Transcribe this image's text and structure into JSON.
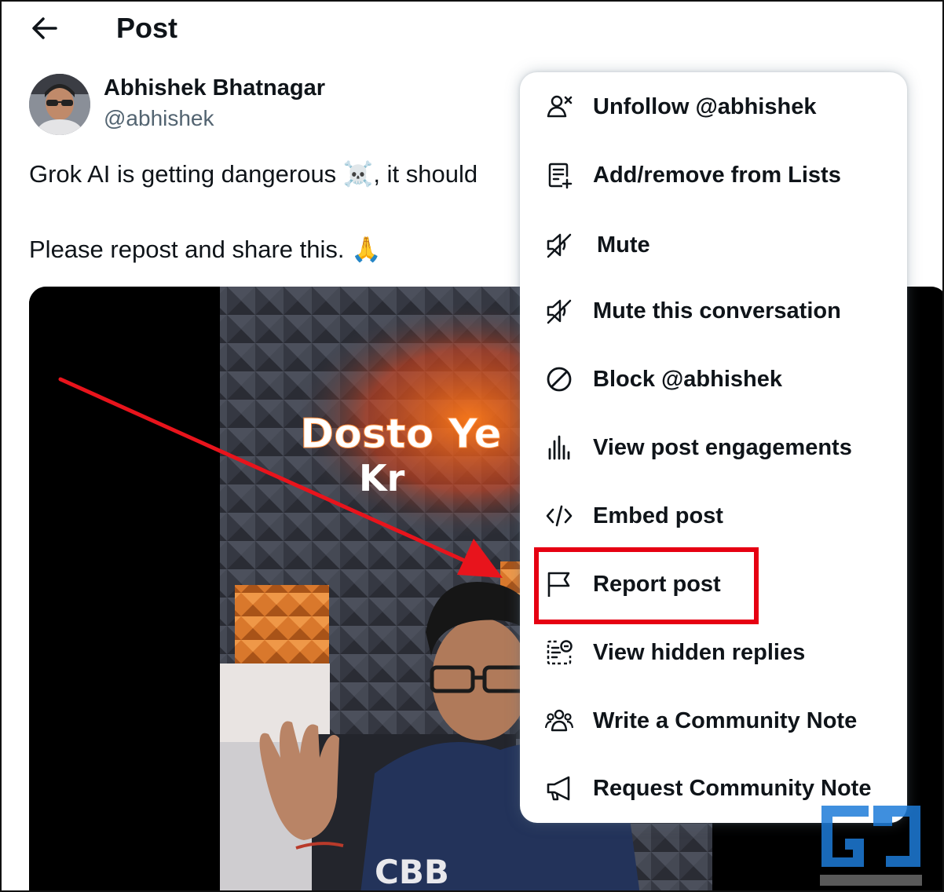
{
  "header": {
    "title": "Post"
  },
  "author": {
    "name": "Abhishek Bhatnagar",
    "handle": "@abhishek"
  },
  "tweet": {
    "line1": "Grok AI is getting dangerous ☠️, it should",
    "line2": "Please repost and share this. 🙏"
  },
  "video": {
    "overlay_text_1": "Dosto Ye",
    "overlay_text_2": "Kr",
    "shirt_text": "CBB"
  },
  "menu": {
    "items": [
      {
        "label": "Unfollow @abhishek",
        "icon": "unfollow-icon"
      },
      {
        "label": "Add/remove from Lists",
        "icon": "list-add-icon"
      },
      {
        "label": "Mute",
        "icon": "mute-icon"
      },
      {
        "label": "Mute this conversation",
        "icon": "mute-conversation-icon"
      },
      {
        "label": "Block @abhishek",
        "icon": "block-icon"
      },
      {
        "label": "View post engagements",
        "icon": "engagements-icon"
      },
      {
        "label": "Embed post",
        "icon": "embed-icon"
      },
      {
        "label": "Report post",
        "icon": "flag-icon"
      },
      {
        "label": "View hidden replies",
        "icon": "hidden-replies-icon"
      },
      {
        "label": "Write a Community Note",
        "icon": "community-icon"
      },
      {
        "label": "Request Community Note",
        "icon": "megaphone-icon"
      }
    ]
  },
  "annotation": {
    "highlight_color": "#e60012",
    "arrow_color": "#e8141c"
  },
  "colors": {
    "text": "#0f1419",
    "secondary": "#536471"
  }
}
